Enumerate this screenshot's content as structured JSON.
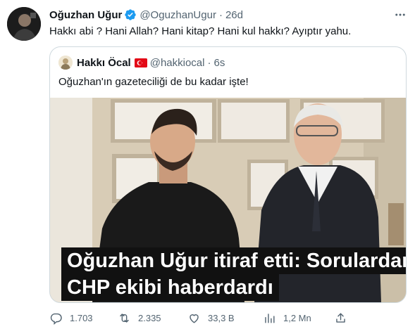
{
  "tweet": {
    "author_name": "Oğuzhan Uğur",
    "author_handle": "@OguzhanUgur",
    "time": "26d",
    "separator": "·",
    "text": "Hakkı abi ? Hani Allah? Hani kitap? Hani kul hakkı? Ayıptır yahu.",
    "more_icon": "more-horizontal-icon"
  },
  "quoted": {
    "author_name": "Hakkı Öcal",
    "author_handle": "@hakkiocal",
    "time": "6s",
    "separator": "·",
    "text": "Oğuzhan'ın gazeteciliği de bu kadar işte!",
    "media": {
      "headline_line1": "Oğuzhan Uğur itiraf etti: Sorulardan",
      "headline_line2": "CHP ekibi haberdardı"
    }
  },
  "actions": {
    "replies": "1.703",
    "retweets": "2.335",
    "likes": "33,3 B",
    "views": "1,2 Mn"
  },
  "colors": {
    "verified": "#1d9bf0",
    "text_secondary": "#536471",
    "border": "#cfd9de",
    "flag": "#e30a17"
  }
}
